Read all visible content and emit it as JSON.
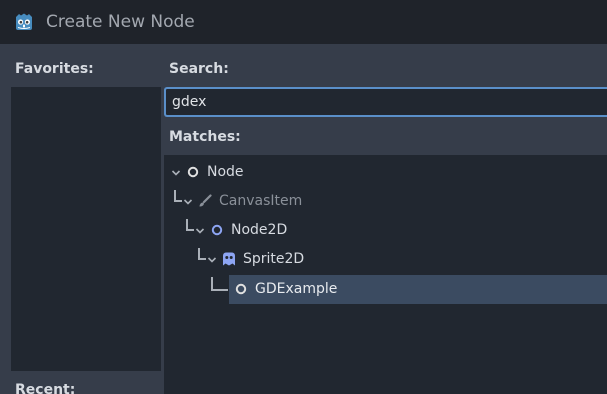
{
  "window": {
    "title": "Create New Node"
  },
  "favorites": {
    "label": "Favorites:"
  },
  "recent": {
    "label": "Recent:"
  },
  "search": {
    "label": "Search:",
    "value": "gdex",
    "placeholder": ""
  },
  "matches": {
    "label": "Matches:",
    "items": [
      {
        "label": "Node",
        "icon": "node-circle-icon",
        "depth": 0,
        "expanded": true,
        "selected": false,
        "dimmed": false
      },
      {
        "label": "CanvasItem",
        "icon": "brush-icon",
        "depth": 1,
        "expanded": true,
        "selected": false,
        "dimmed": true
      },
      {
        "label": "Node2D",
        "icon": "node2d-circle-icon",
        "depth": 2,
        "expanded": true,
        "selected": false,
        "dimmed": false
      },
      {
        "label": "Sprite2D",
        "icon": "sprite-icon",
        "depth": 3,
        "expanded": true,
        "selected": false,
        "dimmed": false
      },
      {
        "label": "GDExample",
        "icon": "node-circle-icon",
        "depth": 4,
        "expanded": false,
        "selected": true,
        "dimmed": false
      }
    ]
  },
  "colors": {
    "accent": "#5a8fc9",
    "node2d_icon": "#8da5f3",
    "selection": "#3b4b61",
    "panel_bg": "#212730",
    "window_bg": "#363d4a"
  }
}
